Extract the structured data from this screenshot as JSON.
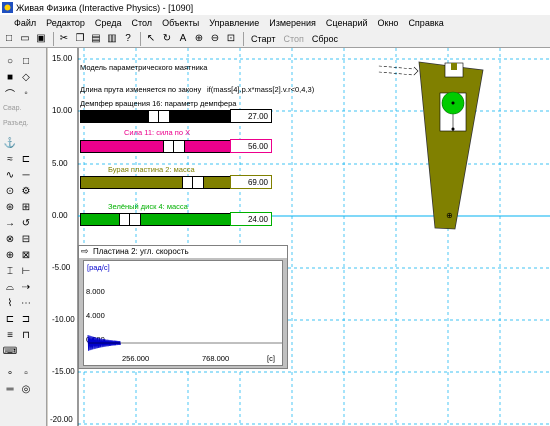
{
  "window": {
    "title": "Живая Физика (Interactive Physics) - [1090]"
  },
  "menu": [
    "Файл",
    "Редактор",
    "Среда",
    "Стол",
    "Объекты",
    "Управление",
    "Измерения",
    "Сценарий",
    "Окно",
    "Справка"
  ],
  "toolbar": {
    "run": "Старт",
    "stop": "Стоп",
    "reset": "Сброс"
  },
  "leftpanel": {
    "weld": "Свар.",
    "split": "Разъед."
  },
  "axis": {
    "yticks": [
      "15.00",
      "10.00",
      "5.00",
      "0.00",
      "-5.00",
      "-10.00",
      "-15.00",
      "-20.00"
    ]
  },
  "scene": {
    "title": "Модель параметрического маятника",
    "rod_law": "Длина прута изменяется по закону",
    "rod_formula": "if(mass[4].p.x*mass[2].v.r<0,4,3)",
    "damper": "Демпфер вращения 16: параметр демпфера"
  },
  "sliders": [
    {
      "label": "Демпфер вращения 16: параметр демпфера",
      "value": "27.00",
      "fraction": 0.45,
      "color": "#000000",
      "labelColor": "#000000"
    },
    {
      "label": "Сила 11: сила по X",
      "value": "56.00",
      "fraction": 0.56,
      "color": "#ec008c",
      "labelColor": "#ec008c"
    },
    {
      "label": "Бурая пластина 2: масса",
      "value": "69.00",
      "fraction": 0.69,
      "color": "#808000",
      "labelColor": "#808000"
    },
    {
      "label": "Зелёный диск 4: масса",
      "value": "24.00",
      "fraction": 0.24,
      "color": "#00b000",
      "labelColor": "#00b000"
    }
  ],
  "graph": {
    "title": "Пластина 2: угл. скорость",
    "unit": "[рад/с]",
    "y_labels": [
      "8.000",
      "4.000",
      "0.000"
    ],
    "x_labels": [
      "256.000",
      "768.000"
    ],
    "x_unit": "[с]",
    "bg": "#ffffff",
    "line_color": "#0000cc"
  },
  "colors": {
    "plate": "#808000",
    "disk": "#00cc00",
    "grid": "#00b0f0"
  }
}
